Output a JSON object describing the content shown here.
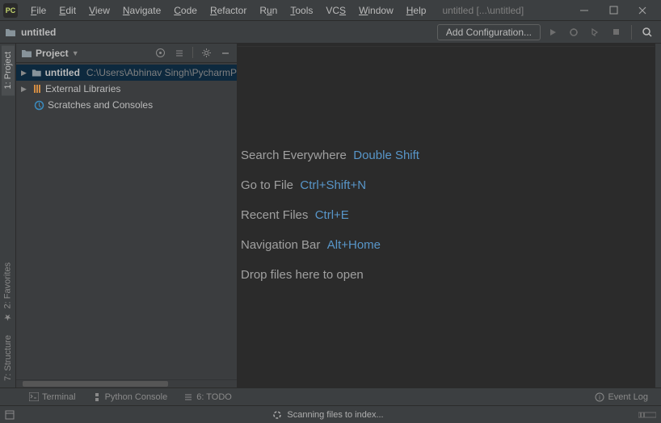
{
  "app": {
    "icon_text": "PC"
  },
  "menu": {
    "file": "File",
    "edit": "Edit",
    "view": "View",
    "navigate": "Navigate",
    "code": "Code",
    "refactor": "Refactor",
    "run": "Run",
    "tools": "Tools",
    "vcs": "VCS",
    "window": "Window",
    "help": "Help"
  },
  "title": "untitled [...\\untitled]",
  "navbar": {
    "project_name": "untitled",
    "add_config": "Add Configuration..."
  },
  "gutter": {
    "project": "1: Project",
    "favorites": "2: Favorites",
    "structure": "7: Structure"
  },
  "panel": {
    "title": "Project"
  },
  "tree": {
    "root_name": "untitled",
    "root_path": "C:\\Users\\Abhinav Singh\\PycharmP",
    "external_libs": "External Libraries",
    "scratches": "Scratches and Consoles"
  },
  "welcome": {
    "search_label": "Search Everywhere",
    "search_shortcut": "Double Shift",
    "gotofile_label": "Go to File",
    "gotofile_shortcut": "Ctrl+Shift+N",
    "recent_label": "Recent Files",
    "recent_shortcut": "Ctrl+E",
    "navbar_label": "Navigation Bar",
    "navbar_shortcut": "Alt+Home",
    "drop_label": "Drop files here to open"
  },
  "bottom_tabs": {
    "terminal": "Terminal",
    "python_console": "Python Console",
    "todo": "6: TODO",
    "event_log": "Event Log"
  },
  "status": {
    "scanning": "Scanning files to index..."
  }
}
